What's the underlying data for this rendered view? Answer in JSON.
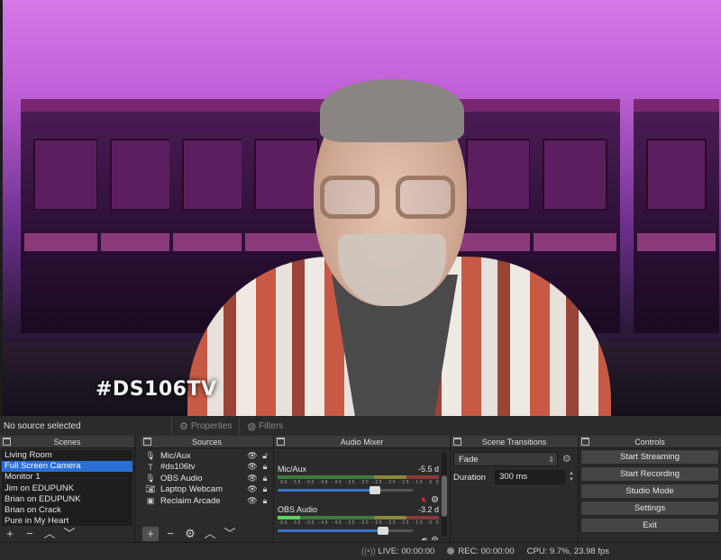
{
  "preview": {
    "watermark": "#DS106TV"
  },
  "status": {
    "no_source": "No source selected",
    "properties_label": "Properties",
    "filters_label": "Filters"
  },
  "scenes": {
    "title": "Scenes",
    "items": [
      "Living Room",
      "Full Screen Camera",
      "Monitor 1",
      "Jim on EDUPUNK",
      "Brian on EDUPUNK",
      "Brian on Crack",
      "Pure in My Heart"
    ],
    "selected_index": 1
  },
  "sources": {
    "title": "Sources",
    "items": [
      {
        "icon": "mic-icon",
        "name": "Mic/Aux"
      },
      {
        "icon": "text-icon",
        "name": "#ds106tv"
      },
      {
        "icon": "mic-icon",
        "name": "OBS Audio"
      },
      {
        "icon": "camera-icon",
        "name": "Laptop Webcam"
      },
      {
        "icon": "image-icon",
        "name": "Reclaim Arcade"
      }
    ]
  },
  "mixer": {
    "title": "Audio Mixer",
    "ticks": "-60 -55 -50 -45 -40 -35 -30 -25 -20 -15 -10 -5 0",
    "channels": [
      {
        "name": "Mic/Aux",
        "level": "-5.5 d",
        "volume": 0.72,
        "muted": true
      },
      {
        "name": "OBS Audio",
        "level": "-3.2 d",
        "volume": 0.78,
        "muted": false
      }
    ]
  },
  "transitions": {
    "title": "Scene Transitions",
    "selected": "Fade",
    "duration_label": "Duration",
    "duration_value": "300 ms"
  },
  "controls": {
    "title": "Controls",
    "buttons": [
      "Start Streaming",
      "Start Recording",
      "Studio Mode",
      "Settings",
      "Exit"
    ]
  },
  "bottom": {
    "live": "LIVE: 00:00:00",
    "rec": "REC: 00:00:00",
    "cpu": "CPU: 9.7%, 23.98 fps"
  }
}
